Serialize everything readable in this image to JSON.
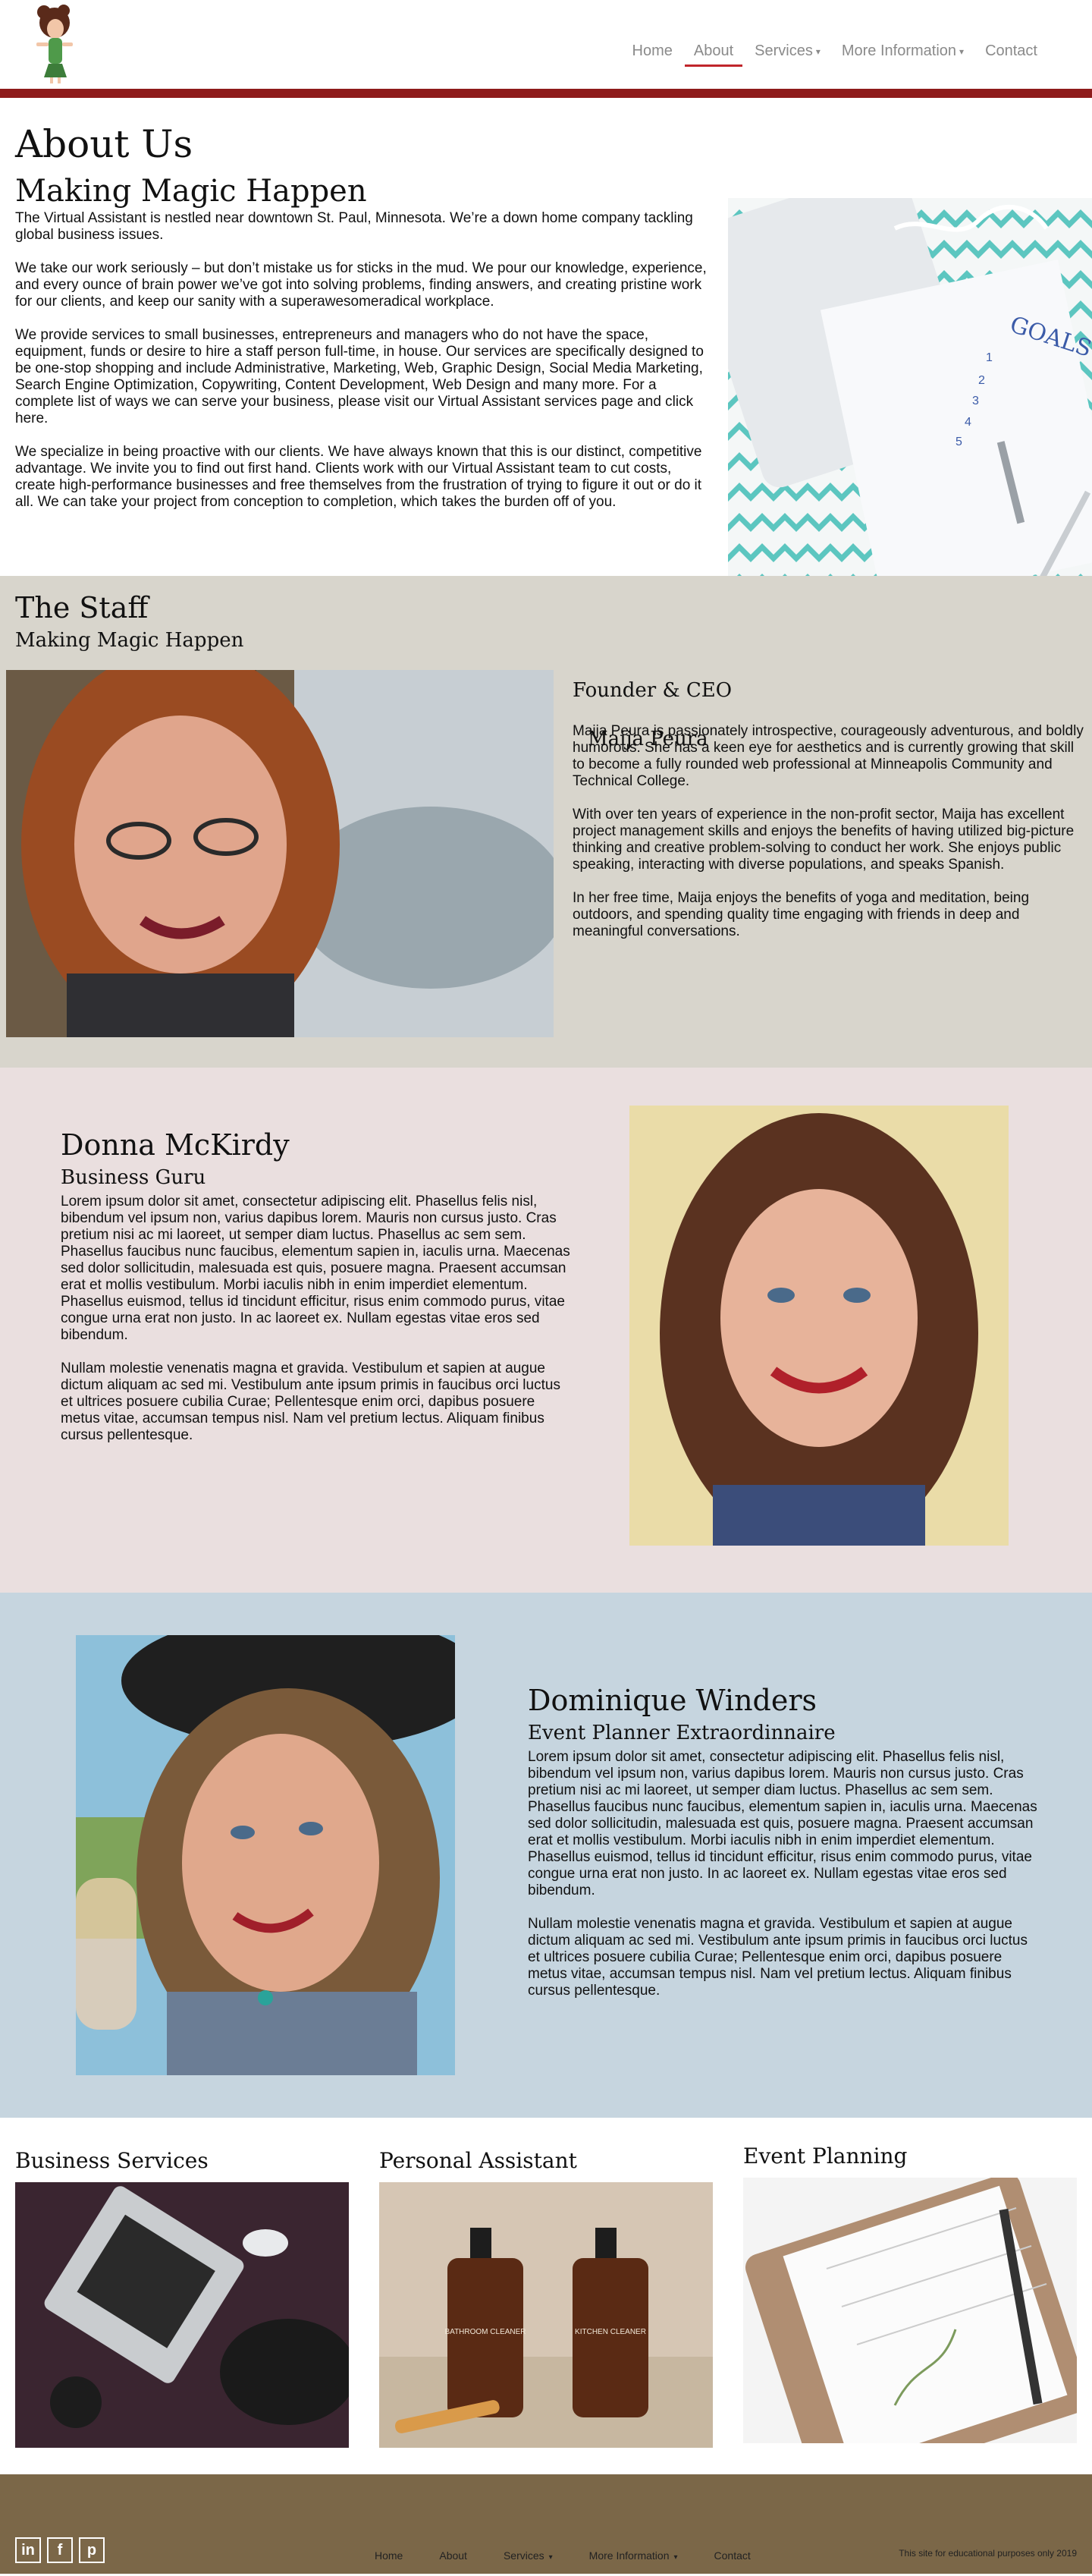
{
  "nav": {
    "items": [
      {
        "label": "Home",
        "active": false,
        "dropdown": false
      },
      {
        "label": "About",
        "active": true,
        "dropdown": false
      },
      {
        "label": "Services",
        "active": false,
        "dropdown": true
      },
      {
        "label": "More Information",
        "active": false,
        "dropdown": true
      },
      {
        "label": "Contact",
        "active": false,
        "dropdown": false
      }
    ],
    "accent_color": "#8e1b1b"
  },
  "about": {
    "title": "About Us",
    "subtitle": "Making Magic Happen",
    "paragraphs": [
      "The Virtual Assistant is nestled near downtown St. Paul, Minnesota. We’re a down home company tackling global business issues.",
      "We take our work seriously – but don’t mistake us for sticks in the mud. We pour our knowledge, experience, and every ounce of brain power we’ve got into solving problems, finding answers, and creating pristine work for our clients, and keep our sanity with a superawesomeradical workplace.",
      "We provide services to small businesses, entrepreneurs and managers who do not have the space, equipment, funds or desire to hire a staff person full-time, in house. Our services are specifically designed to be one-stop shopping and include Administrative, Marketing, Web, Graphic Design, Social Media Marketing, Search Engine Optimization, Copywriting, Content Development, Web Design and many more. For a complete list of ways we can serve your business, please visit our Virtual Assistant services page and click here.",
      "We specialize in being proactive with our clients. We have always known that this is our distinct, competitive advantage. We invite you to find out first hand. Clients work with our Virtual Assistant team to cut costs, create high-performance businesses and free themselves from the frustration of trying to figure it out or do it all. We can take your project from conception to completion, which takes the burden off of you."
    ],
    "image_text": "GOALS"
  },
  "staff": {
    "title": "The Staff",
    "subtitle": "Making Magic Happen",
    "members": [
      {
        "name": "Maija Peura",
        "role": "Founder & CEO",
        "paragraphs": [
          "Maija Peura is passionately introspective, courageously adventurous, and boldly humorous. She has a keen eye for aesthetics and is currently growing that skill to become a fully rounded web professional at Minneapolis Community and Technical College.",
          "With over ten years of experience in the non-profit sector, Maija has excellent project management skills and enjoys the benefits of having utilized big-picture thinking and creative problem-solving to conduct her work. She enjoys public speaking, interacting with diverse populations, and speaks Spanish.",
          "In her free time, Maija enjoys the benefits of yoga and meditation, being outdoors, and spending quality time engaging with friends in deep and meaningful conversations."
        ]
      },
      {
        "name": "Donna McKirdy",
        "role": "Business Guru",
        "paragraphs": [
          "Lorem ipsum dolor sit amet, consectetur adipiscing elit. Phasellus felis nisl, bibendum vel ipsum non, varius dapibus lorem. Mauris non cursus justo. Cras pretium nisi ac mi laoreet, ut semper diam luctus. Phasellus ac sem sem. Phasellus faucibus nunc faucibus, elementum sapien in, iaculis urna. Maecenas sed dolor sollicitudin, malesuada est quis, posuere magna. Praesent accumsan erat et mollis vestibulum. Morbi iaculis nibh in enim imperdiet elementum. Phasellus euismod, tellus id tincidunt efficitur, risus enim commodo purus, vitae congue urna erat non justo. In ac laoreet ex. Nullam egestas vitae eros sed bibendum.",
          "Nullam molestie venenatis magna et gravida. Vestibulum et sapien at augue dictum aliquam ac sed mi. Vestibulum ante ipsum primis in faucibus orci luctus et ultrices posuere cubilia Curae; Pellentesque enim orci, dapibus posuere metus vitae, accumsan tempus nisl. Nam vel pretium lectus. Aliquam finibus cursus pellentesque."
        ]
      },
      {
        "name": "Dominique Winders",
        "role": "Event Planner Extraordinnaire",
        "paragraphs": [
          "Lorem ipsum dolor sit amet, consectetur adipiscing elit. Phasellus felis nisl, bibendum vel ipsum non, varius dapibus lorem. Mauris non cursus justo. Cras pretium nisi ac mi laoreet, ut semper diam luctus. Phasellus ac sem sem. Phasellus faucibus nunc faucibus, elementum sapien in, iaculis urna. Maecenas sed dolor sollicitudin, malesuada est quis, posuere magna. Praesent accumsan erat et mollis vestibulum. Morbi iaculis nibh in enim imperdiet elementum. Phasellus euismod, tellus id tincidunt efficitur, risus enim commodo purus, vitae congue urna erat non justo. In ac laoreet ex. Nullam egestas vitae eros sed bibendum.",
          "Nullam molestie venenatis magna et gravida. Vestibulum et sapien at augue dictum aliquam ac sed mi. Vestibulum ante ipsum primis in faucibus orci luctus et ultrices posuere cubilia Curae; Pellentesque enim orci, dapibus posuere metus vitae, accumsan tempus nisl. Nam vel pretium lectus. Aliquam finibus cursus pellentesque."
        ]
      }
    ]
  },
  "services": [
    {
      "title": "Business Services"
    },
    {
      "title": "Personal Assistant",
      "bottle_labels": [
        "BATHROOM CLEANER",
        "KITCHEN CLEANER"
      ]
    },
    {
      "title": "Event Planning"
    }
  ],
  "footer": {
    "social": [
      "linkedin-icon",
      "facebook-icon",
      "pinterest-icon"
    ],
    "nav": [
      {
        "label": "Home",
        "dropdown": false
      },
      {
        "label": "About",
        "dropdown": false
      },
      {
        "label": "Services",
        "dropdown": true
      },
      {
        "label": "More Information",
        "dropdown": true
      },
      {
        "label": "Contact",
        "dropdown": false
      }
    ],
    "fine_print": "This site for educational purposes only 2019",
    "bg_color": "#7b6748"
  }
}
